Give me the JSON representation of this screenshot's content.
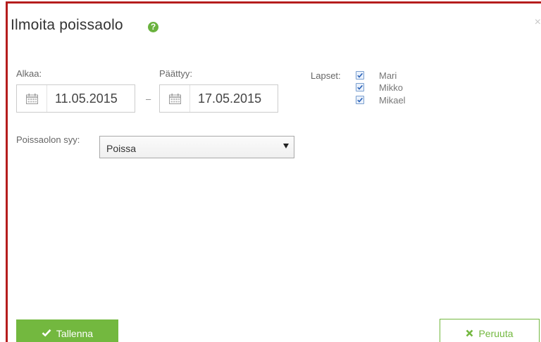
{
  "dialog": {
    "title": "Ilmoita poissaolo",
    "help_icon": "question-circle-icon",
    "help_glyph": "?",
    "close_glyph": "×"
  },
  "start": {
    "label": "Alkaa:",
    "value": "11.05.2015",
    "icon": "calendar-icon"
  },
  "range_separator": "–",
  "end": {
    "label": "Päättyy:",
    "value": "17.05.2015",
    "icon": "calendar-icon"
  },
  "children": {
    "label": "Lapset:",
    "items": [
      {
        "name": "Mari",
        "checked": true
      },
      {
        "name": "Mikko",
        "checked": true
      },
      {
        "name": "Mikael",
        "checked": true
      }
    ]
  },
  "reason": {
    "label": "Poissaolon syy:",
    "selected": "Poissa"
  },
  "actions": {
    "save_label": "Tallenna",
    "save_icon": "check-icon",
    "cancel_label": "Peruuta",
    "cancel_icon": "times-icon"
  },
  "colors": {
    "accent_green": "#73b83f",
    "border_red": "#b51d1d"
  }
}
